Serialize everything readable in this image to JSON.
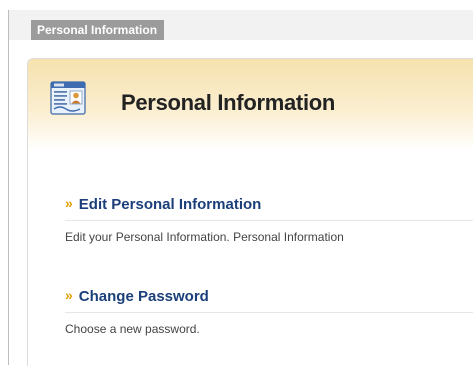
{
  "breadcrumb": {
    "label": "Personal Information"
  },
  "header": {
    "title": "Personal Information",
    "icon": "id-card-icon"
  },
  "sections": [
    {
      "link_label": "Edit Personal Information",
      "description": "Edit your Personal Information. Personal Information"
    },
    {
      "link_label": "Change Password",
      "description": "Choose a new password."
    }
  ],
  "colors": {
    "header_band": "#f6e2ae",
    "link": "#1b3f7a",
    "chevron": "#e0a000",
    "breadcrumb_tab": "#9b9b9b"
  }
}
